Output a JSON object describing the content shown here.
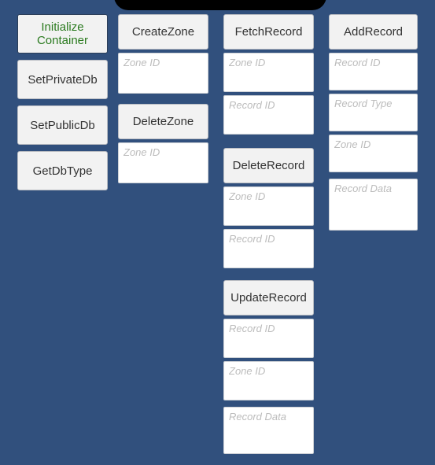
{
  "app": {
    "background_color": "#31507d",
    "notch": "device-notch"
  },
  "colors": {
    "background": "#31507d",
    "button_face": "#f2f2f2",
    "button_text": "#333333",
    "highlight_text": "#2a7a1e",
    "placeholder_text": "#bcbcbc",
    "field_background": "#ffffff",
    "border": "#b9bcc2"
  },
  "columns": [
    {
      "name": "container-actions",
      "groups": [
        {
          "name": "initialize-container",
          "button": "Initialize Container",
          "highlighted": true,
          "fields": []
        },
        {
          "name": "set-private-db",
          "button": "SetPrivateDb",
          "highlighted": false,
          "fields": []
        },
        {
          "name": "set-public-db",
          "button": "SetPublicDb",
          "highlighted": false,
          "fields": []
        },
        {
          "name": "get-db-type",
          "button": "GetDbType",
          "highlighted": false,
          "fields": []
        }
      ]
    },
    {
      "name": "zone-actions",
      "groups": [
        {
          "name": "create-zone",
          "button": "CreateZone",
          "highlighted": false,
          "fields": [
            {
              "name": "zone-id",
              "placeholder": "Zone ID",
              "value": ""
            }
          ]
        },
        {
          "name": "delete-zone",
          "button": "DeleteZone",
          "highlighted": false,
          "fields": [
            {
              "name": "zone-id",
              "placeholder": "Zone ID",
              "value": ""
            }
          ]
        }
      ]
    },
    {
      "name": "record-read-actions",
      "groups": [
        {
          "name": "fetch-record",
          "button": "FetchRecord",
          "highlighted": false,
          "fields": [
            {
              "name": "zone-id",
              "placeholder": "Zone ID",
              "value": ""
            },
            {
              "name": "record-id",
              "placeholder": "Record ID",
              "value": ""
            }
          ]
        },
        {
          "name": "delete-record",
          "button": "DeleteRecord",
          "highlighted": false,
          "fields": [
            {
              "name": "zone-id",
              "placeholder": "Zone ID",
              "value": ""
            },
            {
              "name": "record-id",
              "placeholder": "Record ID",
              "value": ""
            }
          ]
        },
        {
          "name": "update-record",
          "button": "UpdateRecord",
          "highlighted": false,
          "fields": [
            {
              "name": "record-id",
              "placeholder": "Record ID",
              "value": ""
            },
            {
              "name": "zone-id",
              "placeholder": "Zone ID",
              "value": ""
            },
            {
              "name": "record-data",
              "placeholder": "Record Data",
              "value": ""
            }
          ]
        }
      ]
    },
    {
      "name": "record-write-actions",
      "groups": [
        {
          "name": "add-record",
          "button": "AddRecord",
          "highlighted": false,
          "fields": [
            {
              "name": "record-id",
              "placeholder": "Record ID",
              "value": ""
            },
            {
              "name": "record-type",
              "placeholder": "Record Type",
              "value": ""
            },
            {
              "name": "zone-id",
              "placeholder": "Zone ID",
              "value": ""
            },
            {
              "name": "record-data",
              "placeholder": "Record Data",
              "value": ""
            }
          ]
        }
      ]
    }
  ]
}
